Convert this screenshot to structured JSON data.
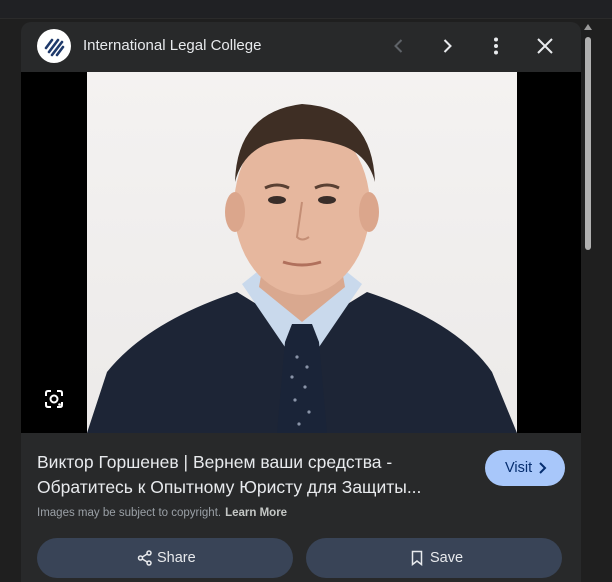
{
  "header": {
    "site_name": "International Legal College",
    "icons": [
      "logo",
      "chevron-left-icon",
      "chevron-right-icon",
      "more-vert-icon",
      "close-icon"
    ]
  },
  "image": {
    "lens_icon": "google-lens-icon"
  },
  "caption": {
    "line1": "Виктор Горшенев | Вернем ваши средства -",
    "line2": "Обратитесь к Опытному Юристу для Защиты..."
  },
  "visit_button": {
    "label": "Visit"
  },
  "copyright": {
    "text": "Images may be subject to copyright.",
    "link": "Learn More"
  },
  "actions": {
    "share_label": "Share",
    "save_label": "Save"
  },
  "colors": {
    "panel": "#28292a",
    "visit_bg": "#a8c7fa",
    "action_bg": "#394457"
  }
}
